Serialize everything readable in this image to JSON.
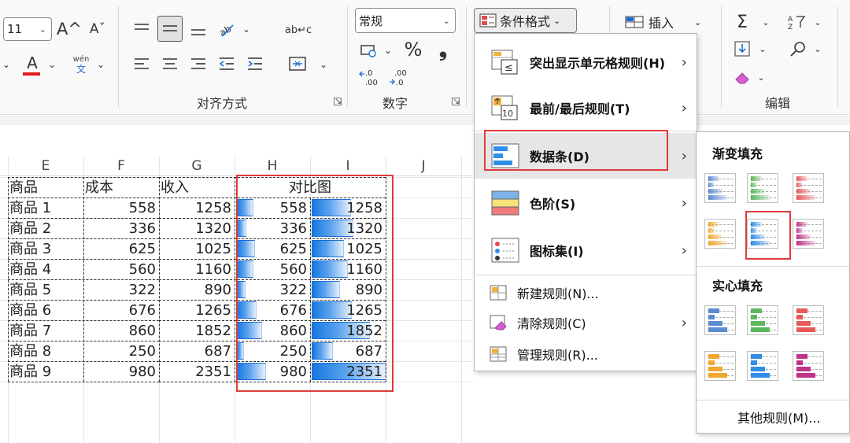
{
  "ribbon": {
    "font_size": "11",
    "grow_font": "A^",
    "shrink_font": "Aˇ",
    "font_color_glyph": "A",
    "phonetic_top": "wén",
    "phonetic_bottom": "文",
    "wrap_glyph": "ab↵c",
    "number_format": "常规",
    "percent": "%",
    "comma": "❟",
    "cond_format": "条件格式",
    "insert": "插入",
    "groups": {
      "alignment": "对齐方式",
      "number": "数字",
      "editing": "编辑"
    }
  },
  "sheet": {
    "columns": [
      "E",
      "F",
      "G",
      "H",
      "I",
      "J"
    ],
    "header_row": {
      "name": "商品",
      "cost": "成本",
      "revenue": "收入",
      "compare": "对比图"
    },
    "rows": [
      {
        "name": "商品 1",
        "cost": "558",
        "revenue": "1258",
        "c1": "558",
        "c2": "1258"
      },
      {
        "name": "商品 2",
        "cost": "336",
        "revenue": "1320",
        "c1": "336",
        "c2": "1320"
      },
      {
        "name": "商品 3",
        "cost": "625",
        "revenue": "1025",
        "c1": "625",
        "c2": "1025"
      },
      {
        "name": "商品 4",
        "cost": "560",
        "revenue": "1160",
        "c1": "560",
        "c2": "1160"
      },
      {
        "name": "商品 5",
        "cost": "322",
        "revenue": "890",
        "c1": "322",
        "c2": "890"
      },
      {
        "name": "商品 6",
        "cost": "676",
        "revenue": "1265",
        "c1": "676",
        "c2": "1265"
      },
      {
        "name": "商品 7",
        "cost": "860",
        "revenue": "1852",
        "c1": "860",
        "c2": "1852"
      },
      {
        "name": "商品 8",
        "cost": "250",
        "revenue": "687",
        "c1": "250",
        "c2": "687"
      },
      {
        "name": "商品 9",
        "cost": "980",
        "revenue": "2351",
        "c1": "980",
        "c2": "2351"
      }
    ]
  },
  "menu": {
    "items": [
      {
        "label": "突出显示单元格规则(H)"
      },
      {
        "label": "最前/最后规则(T)"
      },
      {
        "label": "数据条(D)"
      },
      {
        "label": "色阶(S)"
      },
      {
        "label": "图标集(I)"
      },
      {
        "label": "新建规则(N)..."
      },
      {
        "label": "清除规则(C)"
      },
      {
        "label": "管理规则(R)..."
      }
    ],
    "icon_top10": "10",
    "icon_le": "≤"
  },
  "submenu": {
    "gradient_title": "渐变填充",
    "solid_title": "实心填充",
    "more": "其他规则(M)...",
    "colors": [
      "#5b8bd0",
      "#5cb85c",
      "#e85a5a",
      "#f0a830",
      "#2f8ee8",
      "#c0338a"
    ]
  },
  "colors": {
    "accent_red": "#e03a3a",
    "bar_blue": "#1677e0"
  }
}
